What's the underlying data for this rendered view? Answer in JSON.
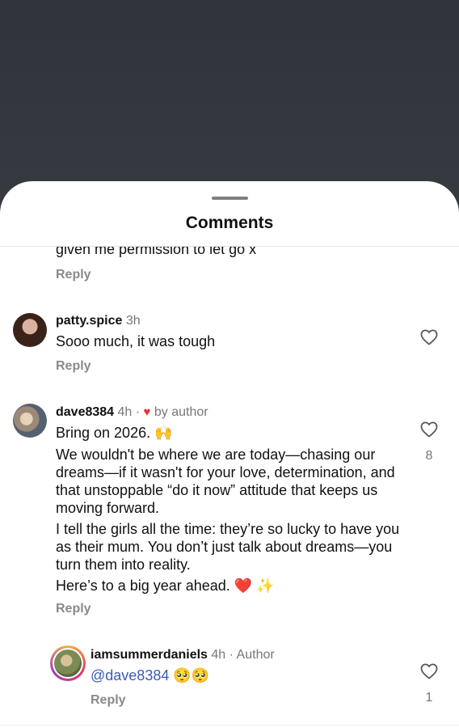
{
  "sheet": {
    "title": "Comments"
  },
  "partial_comment": {
    "text": "given me permission to let go x",
    "reply_label": "Reply"
  },
  "comments": [
    {
      "username": "patty.spice",
      "time": "3h",
      "text": "Sooo much, it was tough",
      "reply_label": "Reply"
    },
    {
      "username": "dave8384",
      "time": "4h",
      "separator": "·",
      "liked_by_author": "by author",
      "paragraphs": [
        "Bring on 2026.",
        "We wouldn't be where we are today—chasing our dreams—if it wasn't for your love, determination, and that unstoppable “do it now” attitude that keeps us moving forward.",
        "I tell the girls all the time: they’re so lucky to have you as their mum. You don’t just talk about dreams—you turn them into reality.",
        "Here’s to a big year ahead."
      ],
      "like_count": "8",
      "reply_label": "Reply"
    }
  ],
  "reply": {
    "username": "iamsummerdaniels",
    "time": "4h",
    "separator": "·",
    "badge": "Author",
    "mention": "@dave8384",
    "like_count": "1",
    "reply_label": "Reply"
  },
  "icons": {
    "raising_hands": "🙌",
    "red_heart": "❤️",
    "sparkles": "✨",
    "pleading_face": "🥺"
  },
  "colors": {
    "accent_link": "#3b5bb5",
    "heart_red": "#e8323c",
    "muted": "#8a8a8a"
  }
}
